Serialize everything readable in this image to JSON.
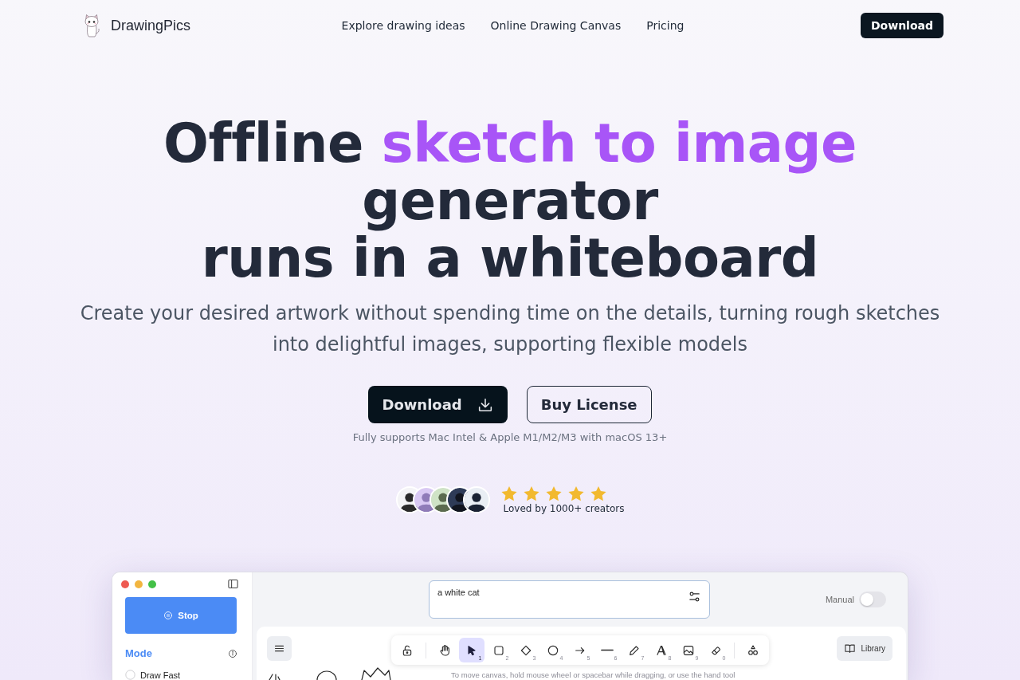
{
  "nav": {
    "brand": "DrawingPics",
    "links": [
      "Explore drawing ideas",
      "Online Drawing Canvas",
      "Pricing"
    ],
    "cta": "Download"
  },
  "hero": {
    "title_lines": [
      [
        {
          "text": "Offline",
          "color": "#232a3a"
        },
        {
          "text": "sketch to image",
          "color": "#a855f7"
        }
      ],
      [
        {
          "text": "generator",
          "color": "#232a3a"
        }
      ],
      [
        {
          "text": "runs in a whiteboard",
          "color": "#232a3a"
        }
      ]
    ],
    "subtitle": "Create your desired artwork without spending time on the details, turning rough sketches into delightful images, supporting flexible models",
    "buttons": [
      {
        "label": "Download",
        "kind": "primary"
      },
      {
        "label": "Buy License",
        "kind": "outline"
      }
    ],
    "note": "Fully supports Mac Intel & Apple M1/M2/M3 with macOS 13+"
  },
  "social_proof": {
    "stars": 5,
    "caption": "Loved by 1000+ creators"
  },
  "app_window": {
    "sidebar": {
      "stop_button": "Stop",
      "section_title": "Mode",
      "modes": [
        {
          "label": "Draw Fast",
          "selected": false
        }
      ]
    },
    "prompt": {
      "value": "a white cat"
    },
    "manual_toggle": {
      "label": "Manual",
      "on": false
    },
    "toolbar": {
      "tool_groups": [
        [
          {
            "kind": "lock",
            "selected": false
          }
        ],
        [
          {
            "kind": "hand",
            "selected": false
          },
          {
            "kind": "select",
            "shortcut": "1",
            "selected": true
          },
          {
            "kind": "rectangle",
            "shortcut": "2",
            "selected": false
          },
          {
            "kind": "diamond",
            "shortcut": "3",
            "selected": false
          },
          {
            "kind": "ellipse",
            "shortcut": "4",
            "selected": false
          },
          {
            "kind": "arrow",
            "shortcut": "5",
            "selected": false
          },
          {
            "kind": "line",
            "shortcut": "6",
            "selected": false
          },
          {
            "kind": "pencil",
            "shortcut": "7",
            "selected": false
          },
          {
            "kind": "text",
            "shortcut": "8",
            "selected": false
          },
          {
            "kind": "image",
            "shortcut": "9",
            "selected": false
          },
          {
            "kind": "eraser",
            "shortcut": "0",
            "selected": false
          }
        ],
        [
          {
            "kind": "shapes",
            "selected": false
          }
        ]
      ]
    },
    "library_button": "Library",
    "hint": "To move canvas, hold mouse wheel or spacebar while dragging, or use the hand tool"
  }
}
